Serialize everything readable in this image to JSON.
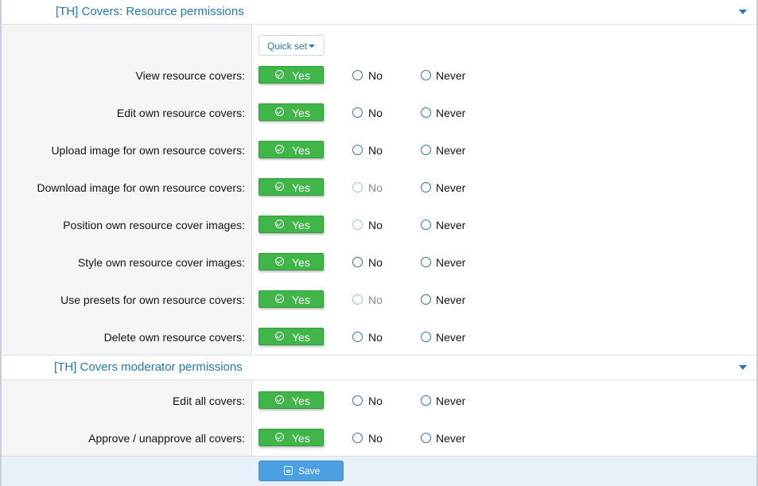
{
  "sections": [
    {
      "title": "[TH] Covers: Resource permissions",
      "quick_set": "Quick set",
      "rows": [
        {
          "label": "View resource covers:",
          "yes": "Yes",
          "no": "No",
          "never": "Never"
        },
        {
          "label": "Edit own resource covers:",
          "yes": "Yes",
          "no": "No",
          "never": "Never"
        },
        {
          "label": "Upload image for own resource covers:",
          "yes": "Yes",
          "no": "No",
          "never": "Never"
        },
        {
          "label": "Download image for own resource covers:",
          "yes": "Yes",
          "no": "No",
          "never": "Never"
        },
        {
          "label": "Position own resource cover images:",
          "yes": "Yes",
          "no": "No",
          "never": "Never"
        },
        {
          "label": "Style own resource cover images:",
          "yes": "Yes",
          "no": "No",
          "never": "Never"
        },
        {
          "label": "Use presets for own resource covers:",
          "yes": "Yes",
          "no": "No",
          "never": "Never"
        },
        {
          "label": "Delete own resource covers:",
          "yes": "Yes",
          "no": "No",
          "never": "Never"
        }
      ]
    },
    {
      "title": "[TH] Covers moderator permissions",
      "rows": [
        {
          "label": "Edit all covers:",
          "yes": "Yes",
          "no": "No",
          "never": "Never"
        },
        {
          "label": "Approve / unapprove all covers:",
          "yes": "Yes",
          "no": "No",
          "never": "Never"
        }
      ]
    }
  ],
  "footer": {
    "save_label": "Save"
  },
  "colors": {
    "accent": "#2577b1",
    "yes_green": "#3fb648",
    "save_blue": "#4aa0e0"
  }
}
